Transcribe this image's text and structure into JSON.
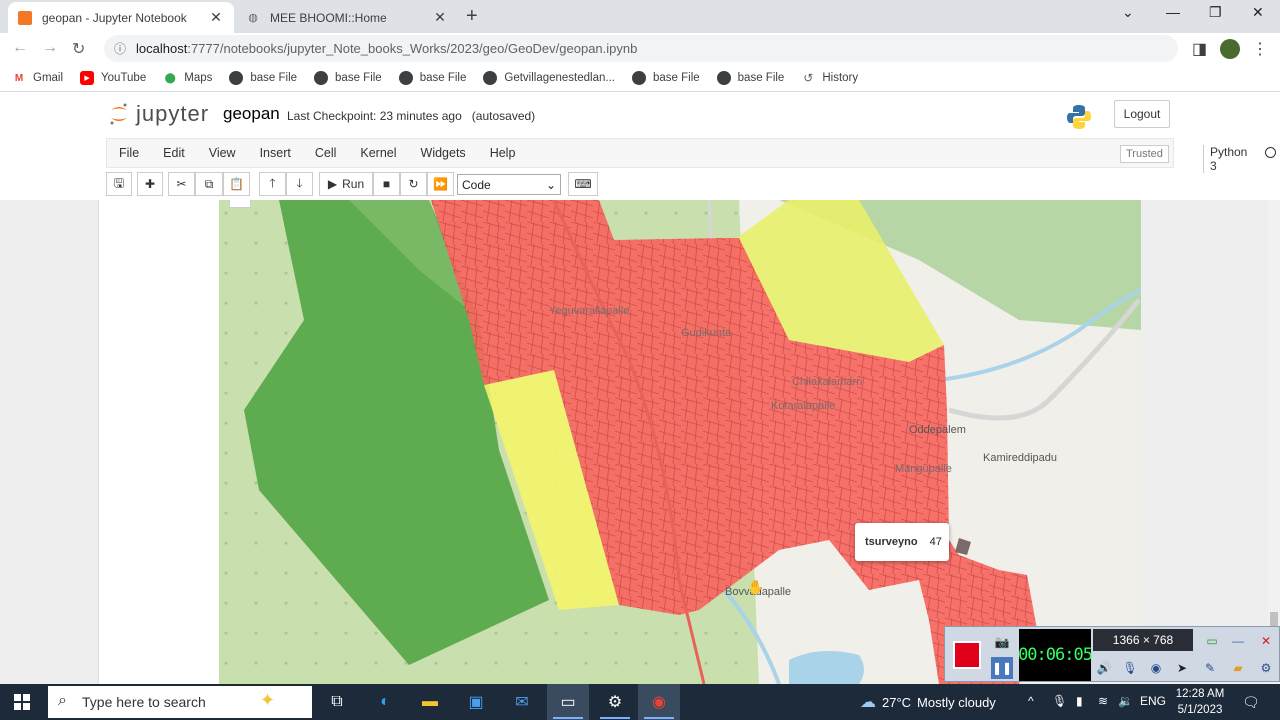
{
  "browser": {
    "tabs": [
      {
        "title": "geopan - Jupyter Notebook",
        "active": true
      },
      {
        "title": "MEE BHOOMI::Home",
        "active": false
      }
    ],
    "url_host": "localhost",
    "url_path": ":7777/notebooks/jupyter_Note_books_Works/2023/geo/GeoDev/geopan.ipynb",
    "bookmarks": [
      {
        "label": "Gmail",
        "icon": "gmail-icon"
      },
      {
        "label": "YouTube",
        "icon": "youtube-icon"
      },
      {
        "label": "Maps",
        "icon": "maps-icon"
      },
      {
        "label": "base File",
        "icon": "globe-icon"
      },
      {
        "label": "base File",
        "icon": "globe-icon"
      },
      {
        "label": "base File",
        "icon": "globe-icon"
      },
      {
        "label": "Getvillagenestedlan...",
        "icon": "globe-icon"
      },
      {
        "label": "base File",
        "icon": "globe-icon"
      },
      {
        "label": "base File",
        "icon": "globe-icon"
      },
      {
        "label": "History",
        "icon": "history-icon"
      }
    ]
  },
  "jupyter": {
    "logo_text": "jupyter",
    "notebook_name": "geopan",
    "checkpoint": "Last Checkpoint: 23 minutes ago",
    "autosaved": "(autosaved)",
    "logout_label": "Logout",
    "menu": [
      "File",
      "Edit",
      "View",
      "Insert",
      "Cell",
      "Kernel",
      "Widgets",
      "Help"
    ],
    "trusted": "Trusted",
    "kernel_name": "Python 3",
    "run_label": "Run",
    "cell_type": "Code"
  },
  "map": {
    "places": [
      "Yeguvarallapalle",
      "Gudikunta",
      "Chilakalamarri",
      "Kotaralapalle",
      "Oddepalem",
      "Kamireddipadu",
      "Mangupalle",
      "Bovvadapalle"
    ],
    "tooltip_key": "tsurveyno",
    "tooltip_value": "47",
    "colors": {
      "red": "#f7665f",
      "yellow": "#f4f46a",
      "green": "#5aa84a",
      "land": "#c9dfae",
      "road": "#eeeeee"
    }
  },
  "recorder": {
    "timer": "00:06:05",
    "resolution": "1366 × 768"
  },
  "taskbar": {
    "search_placeholder": "Type here to search",
    "temperature": "27°C",
    "weather": "Mostly cloudy",
    "language": "ENG",
    "time": "12:28 AM",
    "date": "5/1/2023"
  }
}
